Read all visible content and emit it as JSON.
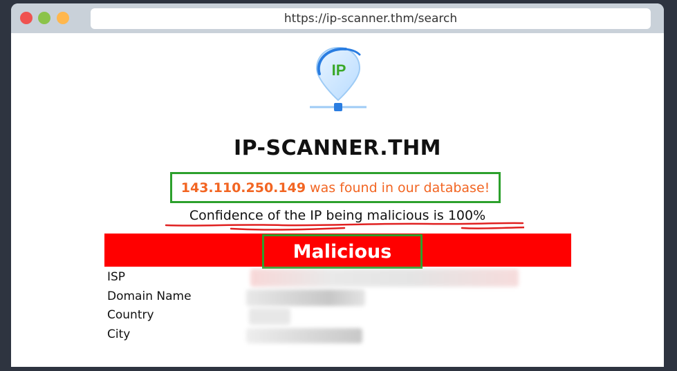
{
  "browser": {
    "url": "https://ip-scanner.thm/search"
  },
  "logo": {
    "text": "IP"
  },
  "site": {
    "title": "IP-SCANNER.THM"
  },
  "result": {
    "ip": "143.110.250.149",
    "found_text": "was found in our database!",
    "confidence_text": "Confidence of the IP being malicious is 100%",
    "verdict": "Malicious"
  },
  "details": [
    {
      "label": "ISP"
    },
    {
      "label": "Domain Name"
    },
    {
      "label": "Country"
    },
    {
      "label": "City"
    }
  ],
  "colors": {
    "accent_orange": "#f26522",
    "highlight_green": "#2ca02c",
    "verdict_red": "#ff0000",
    "annotation_red": "#e02020"
  }
}
